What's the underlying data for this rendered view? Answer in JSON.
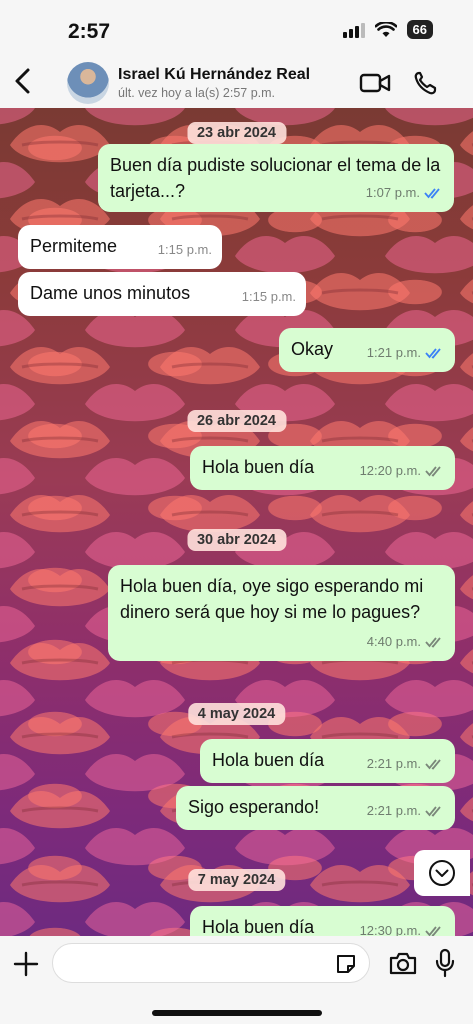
{
  "status_bar": {
    "time": "2:57",
    "battery": "66"
  },
  "header": {
    "contact_name": "Israel Kú Hernández Real",
    "last_seen": "últ. vez hoy a la(s) 2:57 p.m."
  },
  "messages": [
    {
      "type": "date",
      "text": "23 abr 2024"
    },
    {
      "type": "out",
      "text": "Buen día pudiste solucionar el tema de la tarjeta...?",
      "time": "1:07 p.m.",
      "status": "read"
    },
    {
      "type": "in",
      "text": "Permiteme",
      "time": "1:15 p.m."
    },
    {
      "type": "in",
      "text": "Dame unos minutos",
      "time": "1:15 p.m."
    },
    {
      "type": "out",
      "text": "Okay",
      "time": "1:21 p.m.",
      "status": "read"
    },
    {
      "type": "date",
      "text": "26 abr 2024"
    },
    {
      "type": "out",
      "text": "Hola buen día",
      "time": "12:20 p.m.",
      "status": "delivered"
    },
    {
      "type": "date",
      "text": "30 abr 2024"
    },
    {
      "type": "out",
      "text": "Hola buen día, oye sigo esperando mi dinero será que hoy si me lo pagues?",
      "time": "4:40 p.m.",
      "status": "delivered"
    },
    {
      "type": "date",
      "text": "4 may 2024"
    },
    {
      "type": "out",
      "text": "Hola buen día",
      "time": "2:21 p.m.",
      "status": "delivered"
    },
    {
      "type": "out",
      "text": "Sigo esperando!",
      "time": "2:21 p.m.",
      "status": "delivered"
    },
    {
      "type": "date",
      "text": "7 may 2024"
    },
    {
      "type": "out",
      "text": "Hola buen día",
      "time": "12:30 p.m.",
      "status": "delivered"
    }
  ],
  "composer": {
    "value": ""
  },
  "colors": {
    "outgoing": "#d8fdd2",
    "incoming": "#ffffff",
    "read_tick": "#3b82f6",
    "delivered_tick": "#7a877a"
  }
}
